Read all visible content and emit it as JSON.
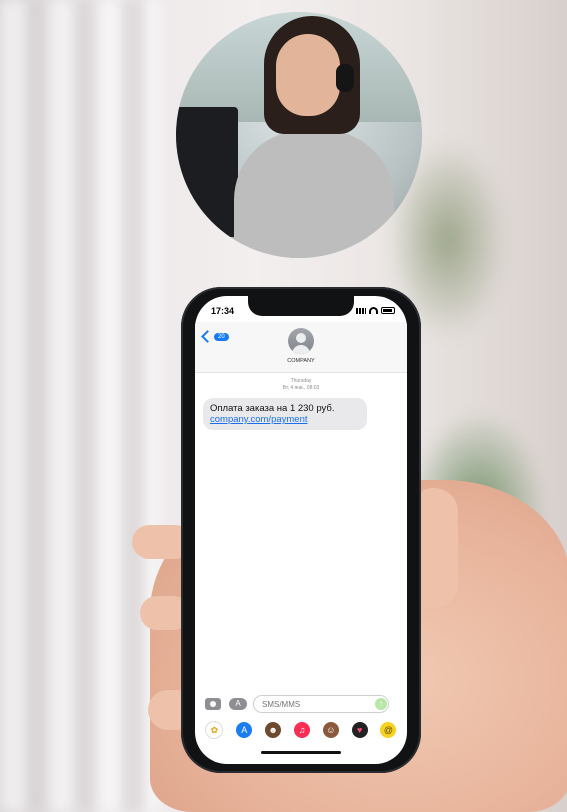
{
  "status_bar": {
    "time": "17:34"
  },
  "header": {
    "back_count": "20",
    "contact_name": "COMPANY"
  },
  "conversation": {
    "day": "Thursday",
    "datetime": "Вт, 4 янв., 08:03",
    "message": {
      "text": "Оплата заказа на 1 230 руб.",
      "link": "company.com/payment"
    }
  },
  "composer": {
    "placeholder": "SMS/MMS",
    "apps_glyph": "A",
    "send_glyph": "↑"
  },
  "app_strip": [
    {
      "icon": "photos-icon",
      "color": "#ffffff",
      "glyph": "✿"
    },
    {
      "icon": "app-store-icon",
      "color": "#1c7cf4",
      "glyph": "A"
    },
    {
      "icon": "memoji-icon",
      "color": "#6b4a2d",
      "glyph": "☻"
    },
    {
      "icon": "music-icon",
      "color": "#fa2d55",
      "glyph": "♫"
    },
    {
      "icon": "animoji-icon",
      "color": "#8b5a3c",
      "glyph": "☺"
    },
    {
      "icon": "heart-icon",
      "color": "#222222",
      "glyph": "♥"
    },
    {
      "icon": "spiral-icon",
      "color": "#f7d21e",
      "glyph": "@"
    }
  ]
}
